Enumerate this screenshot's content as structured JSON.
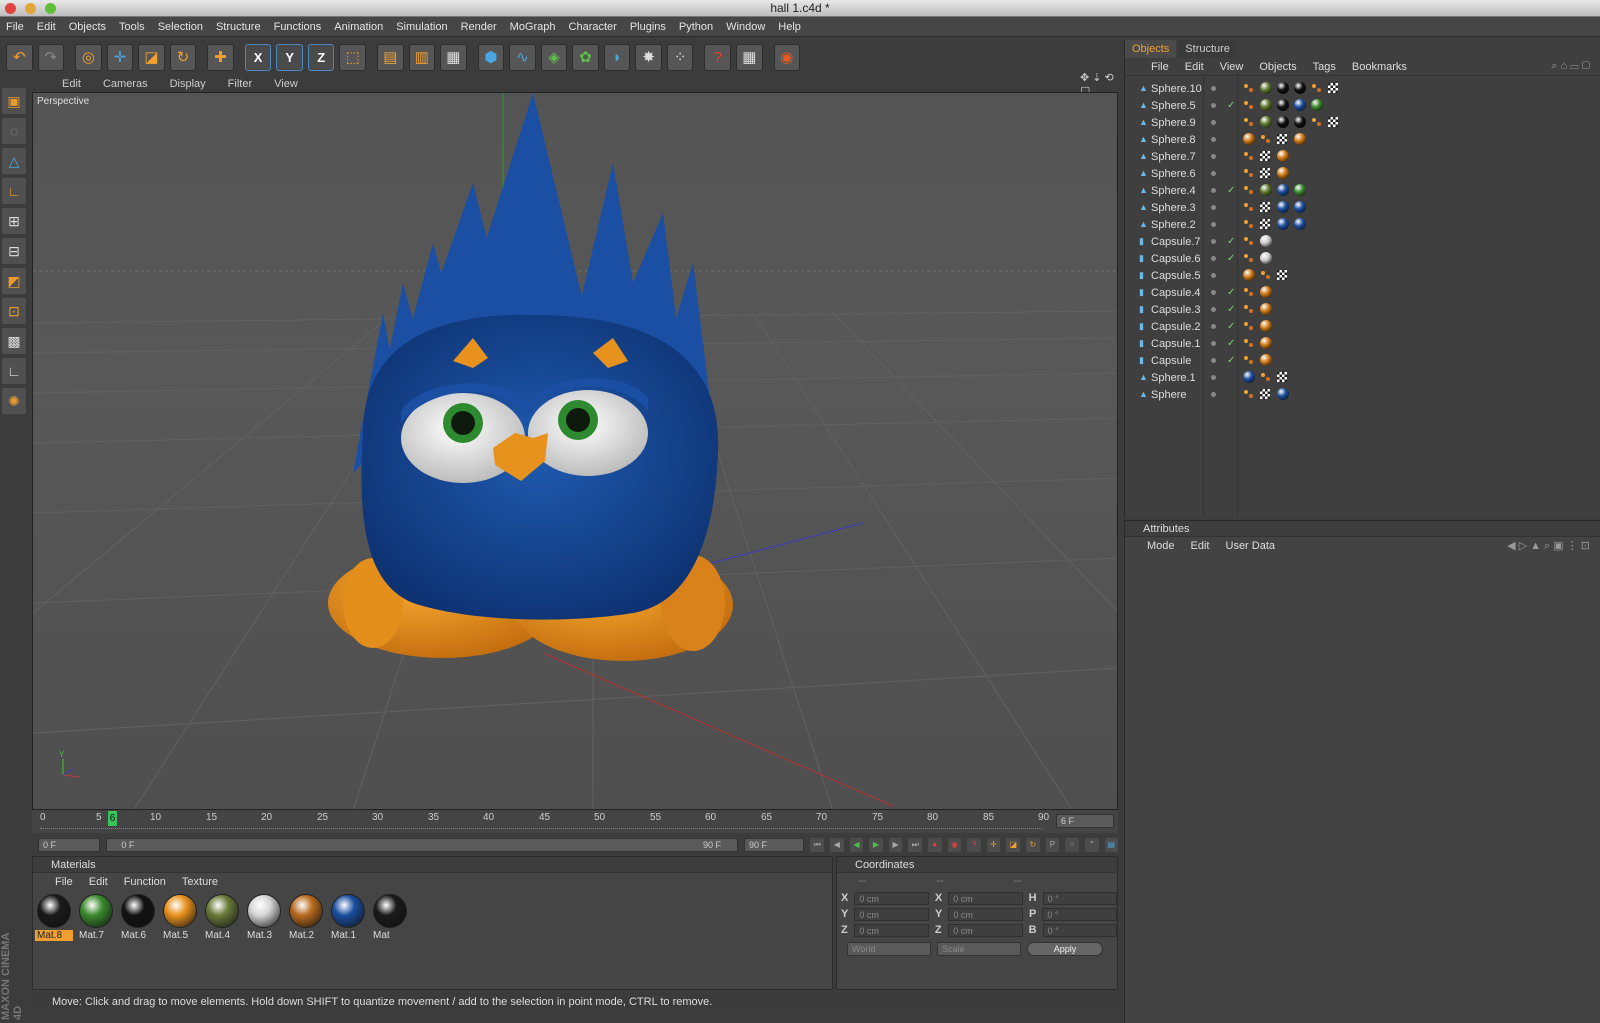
{
  "window": {
    "title": "hall 1.c4d *"
  },
  "menu": [
    "File",
    "Edit",
    "Objects",
    "Tools",
    "Selection",
    "Structure",
    "Functions",
    "Animation",
    "Simulation",
    "Render",
    "MoGraph",
    "Character",
    "Plugins",
    "Python",
    "Window",
    "Help"
  ],
  "viewport": {
    "menu": [
      "Edit",
      "Cameras",
      "Display",
      "Filter",
      "View"
    ],
    "label": "Perspective"
  },
  "timeline": {
    "ticks": [
      "0",
      "5",
      "10",
      "15",
      "20",
      "25",
      "30",
      "35",
      "40",
      "45",
      "50",
      "55",
      "60",
      "65",
      "70",
      "75",
      "80",
      "85",
      "90"
    ],
    "current_marker": "6",
    "current_frame": "6 F",
    "start_field": "0 F",
    "range_start": "0 F",
    "range_end": "90 F",
    "end_field": "90 F"
  },
  "materials": {
    "title": "Materials",
    "menu": [
      "File",
      "Edit",
      "Function",
      "Texture"
    ],
    "items": [
      {
        "name": "Mat.8",
        "color": "#1a1a1a",
        "selected": true
      },
      {
        "name": "Mat.7",
        "color": "#3b8a2d",
        "selected": false
      },
      {
        "name": "Mat.6",
        "color": "#111111",
        "selected": false
      },
      {
        "name": "Mat.5",
        "color": "#e8921e",
        "selected": false
      },
      {
        "name": "Mat.4",
        "color": "#6b7a3a",
        "selected": false
      },
      {
        "name": "Mat.3",
        "color": "#d6d6d6",
        "selected": false
      },
      {
        "name": "Mat.2",
        "color": "#b86a1e",
        "selected": false
      },
      {
        "name": "Mat.1",
        "color": "#1b4ea0",
        "selected": false
      },
      {
        "name": "Mat",
        "color": "#1a1a1a",
        "selected": false
      }
    ]
  },
  "coordinates": {
    "title": "Coordinates",
    "headers": [
      "--",
      "--",
      "--"
    ],
    "rows": [
      {
        "a": "X",
        "av": "0 cm",
        "b": "X",
        "bv": "0 cm",
        "c": "H",
        "cv": "0 °"
      },
      {
        "a": "Y",
        "av": "0 cm",
        "b": "Y",
        "bv": "0 cm",
        "c": "P",
        "cv": "0 °"
      },
      {
        "a": "Z",
        "av": "0 cm",
        "b": "Z",
        "bv": "0 cm",
        "c": "B",
        "cv": "0 °"
      }
    ],
    "space": "World",
    "mode": "Scale",
    "apply": "Apply"
  },
  "objects": {
    "tabs": [
      "Objects",
      "Structure"
    ],
    "menu": [
      "File",
      "Edit",
      "View",
      "Objects",
      "Tags",
      "Bookmarks"
    ],
    "items": [
      {
        "name": "Sphere.10",
        "check": false,
        "tags": [
          "mini",
          "olive",
          "black",
          "black",
          "mini",
          "chk"
        ]
      },
      {
        "name": "Sphere.5",
        "check": true,
        "tags": [
          "mini",
          "olive",
          "black",
          "blue",
          "green"
        ]
      },
      {
        "name": "Sphere.9",
        "check": false,
        "tags": [
          "mini",
          "olive",
          "black",
          "black",
          "mini",
          "chk"
        ]
      },
      {
        "name": "Sphere.8",
        "check": false,
        "tags": [
          "orange",
          "mini",
          "chk",
          "orange"
        ]
      },
      {
        "name": "Sphere.7",
        "check": false,
        "tags": [
          "mini",
          "chk",
          "orange"
        ]
      },
      {
        "name": "Sphere.6",
        "check": false,
        "tags": [
          "mini",
          "chk",
          "orange"
        ]
      },
      {
        "name": "Sphere.4",
        "check": true,
        "tags": [
          "mini",
          "olive",
          "blue",
          "green"
        ]
      },
      {
        "name": "Sphere.3",
        "check": false,
        "tags": [
          "mini",
          "chk",
          "blue",
          "blue"
        ]
      },
      {
        "name": "Sphere.2",
        "check": false,
        "tags": [
          "mini",
          "chk",
          "blue",
          "blue"
        ]
      },
      {
        "name": "Capsule.7",
        "check": true,
        "tags": [
          "mini",
          "white"
        ]
      },
      {
        "name": "Capsule.6",
        "check": true,
        "tags": [
          "mini",
          "white"
        ]
      },
      {
        "name": "Capsule.5",
        "check": false,
        "tags": [
          "orange",
          "mini",
          "chk"
        ]
      },
      {
        "name": "Capsule.4",
        "check": true,
        "tags": [
          "mini",
          "orange"
        ]
      },
      {
        "name": "Capsule.3",
        "check": true,
        "tags": [
          "mini",
          "orange"
        ]
      },
      {
        "name": "Capsule.2",
        "check": true,
        "tags": [
          "mini",
          "orange"
        ]
      },
      {
        "name": "Capsule.1",
        "check": true,
        "tags": [
          "mini",
          "orange"
        ]
      },
      {
        "name": "Capsule",
        "check": true,
        "tags": [
          "mini",
          "orange"
        ]
      },
      {
        "name": "Sphere.1",
        "check": false,
        "tags": [
          "blue",
          "mini",
          "chk"
        ]
      },
      {
        "name": "Sphere",
        "check": false,
        "tags": [
          "mini",
          "chk",
          "blue"
        ]
      }
    ]
  },
  "attributes": {
    "title": "Attributes",
    "menu": [
      "Mode",
      "Edit",
      "User Data"
    ]
  },
  "status": "Move: Click and drag to move elements. Hold down SHIFT to quantize movement / add to the selection in point mode, CTRL to remove.",
  "brand": "MAXON CINEMA 4D",
  "colors": {
    "accent": "#f0a030",
    "blue": "#1d4e9e",
    "orange": "#e8921e"
  }
}
